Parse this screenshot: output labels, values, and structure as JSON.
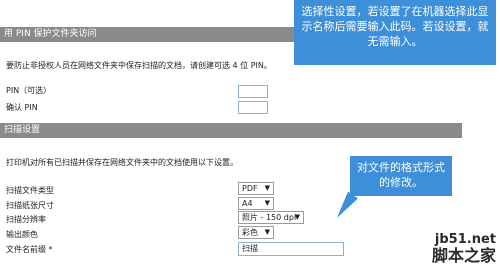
{
  "pin_section": {
    "title": "用 PIN 保护文件夹访问",
    "description": "要防止非授权人员在网络文件夹中保存扫描的文档，请创建可选 4 位 PIN。",
    "pin_label": "PIN（可选）",
    "pin_value": "",
    "confirm_label": "确认 PIN",
    "confirm_value": ""
  },
  "scan_section": {
    "title": "扫描设置",
    "description": "打印机对所有已扫描并保存在网络文件夹中的文档使用以下设置。",
    "file_type_label": "扫描文件类型",
    "file_type_value": "PDF",
    "paper_size_label": "扫描纸张尺寸",
    "paper_size_value": "A4",
    "resolution_label": "扫描分辨率",
    "resolution_value": "照片 - 150 dpi",
    "color_label": "输出颜色",
    "color_value": "彩色",
    "prefix_label": "文件名前缀 *",
    "prefix_value": "扫描"
  },
  "callouts": {
    "top": "选择性设置，若设置了在机器选择此显示名称后需要输入此码。若设设置，就无需输入。",
    "bottom": "对文件的格式形式的修改。"
  },
  "watermark": {
    "site": "jb51.net",
    "name": "脚本之家"
  },
  "colors": {
    "callout": "#3d8fd9",
    "header_bar": "#8a8a8a"
  }
}
